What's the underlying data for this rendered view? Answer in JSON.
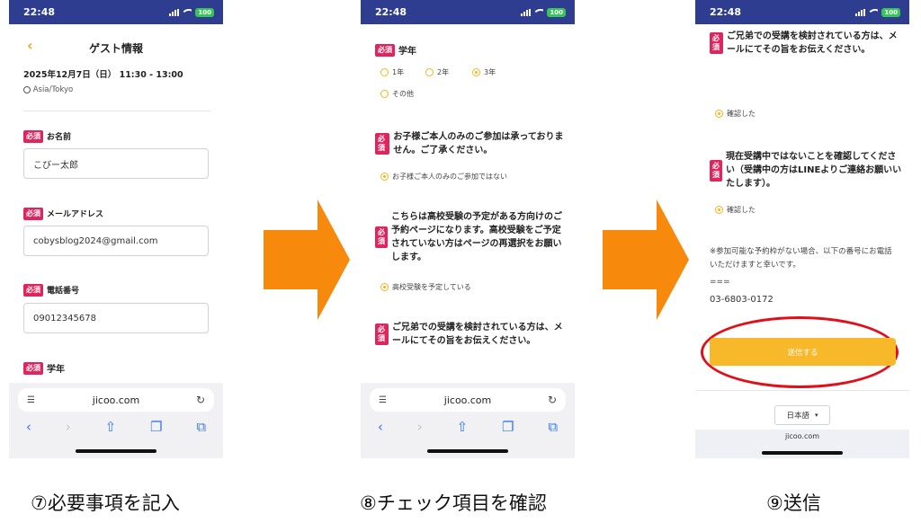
{
  "status_time": "22:48",
  "battery": "100",
  "url": "jicoo.com",
  "badge": "必須",
  "screen1": {
    "back_icon": "chevron-left-icon",
    "title": "ゲスト情報",
    "datetime": "2025年12月7日（日） 11:30 - 13:00",
    "timezone": "Asia/Tokyo",
    "fields": [
      {
        "label": "お名前",
        "value": "こびー太郎"
      },
      {
        "label": "メールアドレス",
        "value": "cobysblog2024@gmail.com"
      },
      {
        "label": "電話番号",
        "value": "09012345678"
      }
    ],
    "grade_label": "学年",
    "caption": "⑦必要事項を記入"
  },
  "screen2": {
    "grade_label": "学年",
    "grade_options": [
      "1年",
      "2年",
      "3年",
      "その他"
    ],
    "grade_selected": "3年",
    "q1": "お子様ご本人のみのご参加は承っておりません。ご了承ください。",
    "a1": "お子様ご本人のみのご参加ではない",
    "q2": "こちらは高校受験の予定がある方向けのご予約ページになります。高校受験をご予定されていない方はページの再選択をお願いします。",
    "a2": "高校受験を予定している",
    "q3": "ご兄弟での受講を検討されている方は、メールにてその旨をお伝えください。",
    "caption": "⑧チェック項目を確認"
  },
  "screen3": {
    "q1": "ご兄弟での受講を検討されている方は、メールにてその旨をお伝えください。",
    "a1": "確認した",
    "q2": "現在受講中ではないことを確認してください（受講中の方はLINEよりご連絡お願いいたします）。",
    "a2": "確認した",
    "note": "※参加可能な予約枠がない場合、以下の番号にお電話いただけますと幸いです。",
    "separator": "===",
    "phone": "03-6803-0172",
    "submit": "送信する",
    "language": "日本語",
    "footer_url": "jicoo.com",
    "caption": "⑨送信"
  },
  "colors": {
    "statusbar": "#2e3d8f",
    "badge": "#e0245e",
    "accent": "#f2b51b",
    "submit": "#f7b92a",
    "arrow": "#f7890c",
    "highlight_circle": "#e0101a"
  }
}
